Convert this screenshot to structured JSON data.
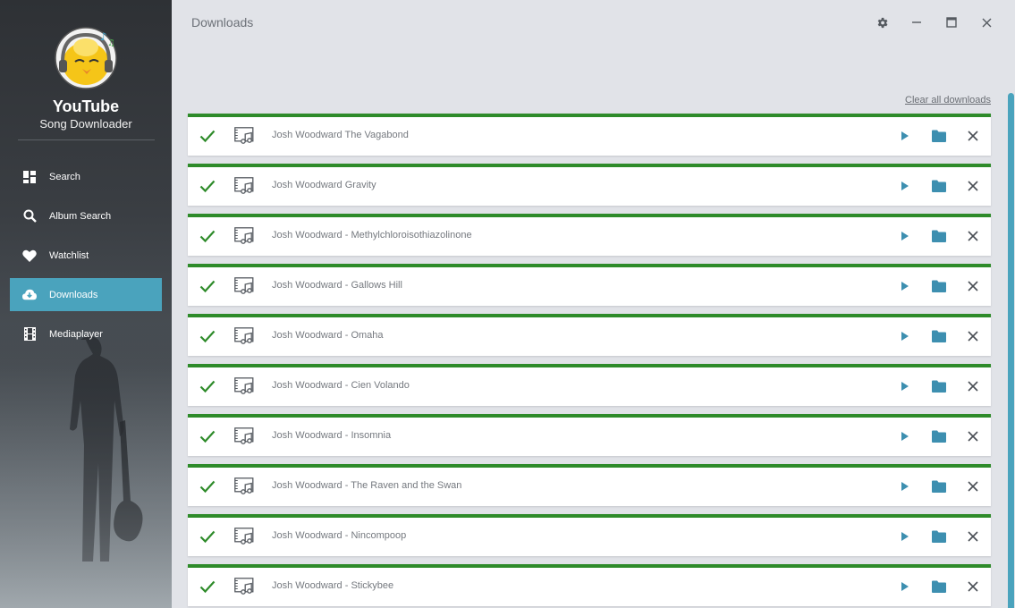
{
  "app": {
    "title": "YouTube",
    "subtitle": "Song Downloader"
  },
  "nav": {
    "items": [
      {
        "label": "Search",
        "icon": "dashboard-icon"
      },
      {
        "label": "Album Search",
        "icon": "magnifier-icon"
      },
      {
        "label": "Watchlist",
        "icon": "heart-icon"
      },
      {
        "label": "Downloads",
        "icon": "cloud-download-icon",
        "active": true
      },
      {
        "label": "Mediaplayer",
        "icon": "film-icon"
      }
    ]
  },
  "page": {
    "title": "Downloads",
    "clear_all_label": "Clear all downloads"
  },
  "colors": {
    "accent": "#4aa3bd",
    "success": "#2e8b2a",
    "folder": "#3d8fb0"
  },
  "downloads": [
    {
      "name": "Josh Woodward The Vagabond",
      "status": "complete"
    },
    {
      "name": "Josh Woodward Gravity",
      "status": "complete"
    },
    {
      "name": "Josh Woodward - Methylchloroisothiazolinone",
      "status": "complete"
    },
    {
      "name": "Josh Woodward - Gallows Hill",
      "status": "complete"
    },
    {
      "name": "Josh Woodward - Omaha",
      "status": "complete"
    },
    {
      "name": "Josh Woodward - Cien Volando",
      "status": "complete"
    },
    {
      "name": "Josh Woodward - Insomnia",
      "status": "complete"
    },
    {
      "name": "Josh Woodward - The Raven and the Swan",
      "status": "complete"
    },
    {
      "name": "Josh Woodward - Nincompoop",
      "status": "complete"
    },
    {
      "name": "Josh Woodward - Stickybee",
      "status": "complete"
    }
  ]
}
